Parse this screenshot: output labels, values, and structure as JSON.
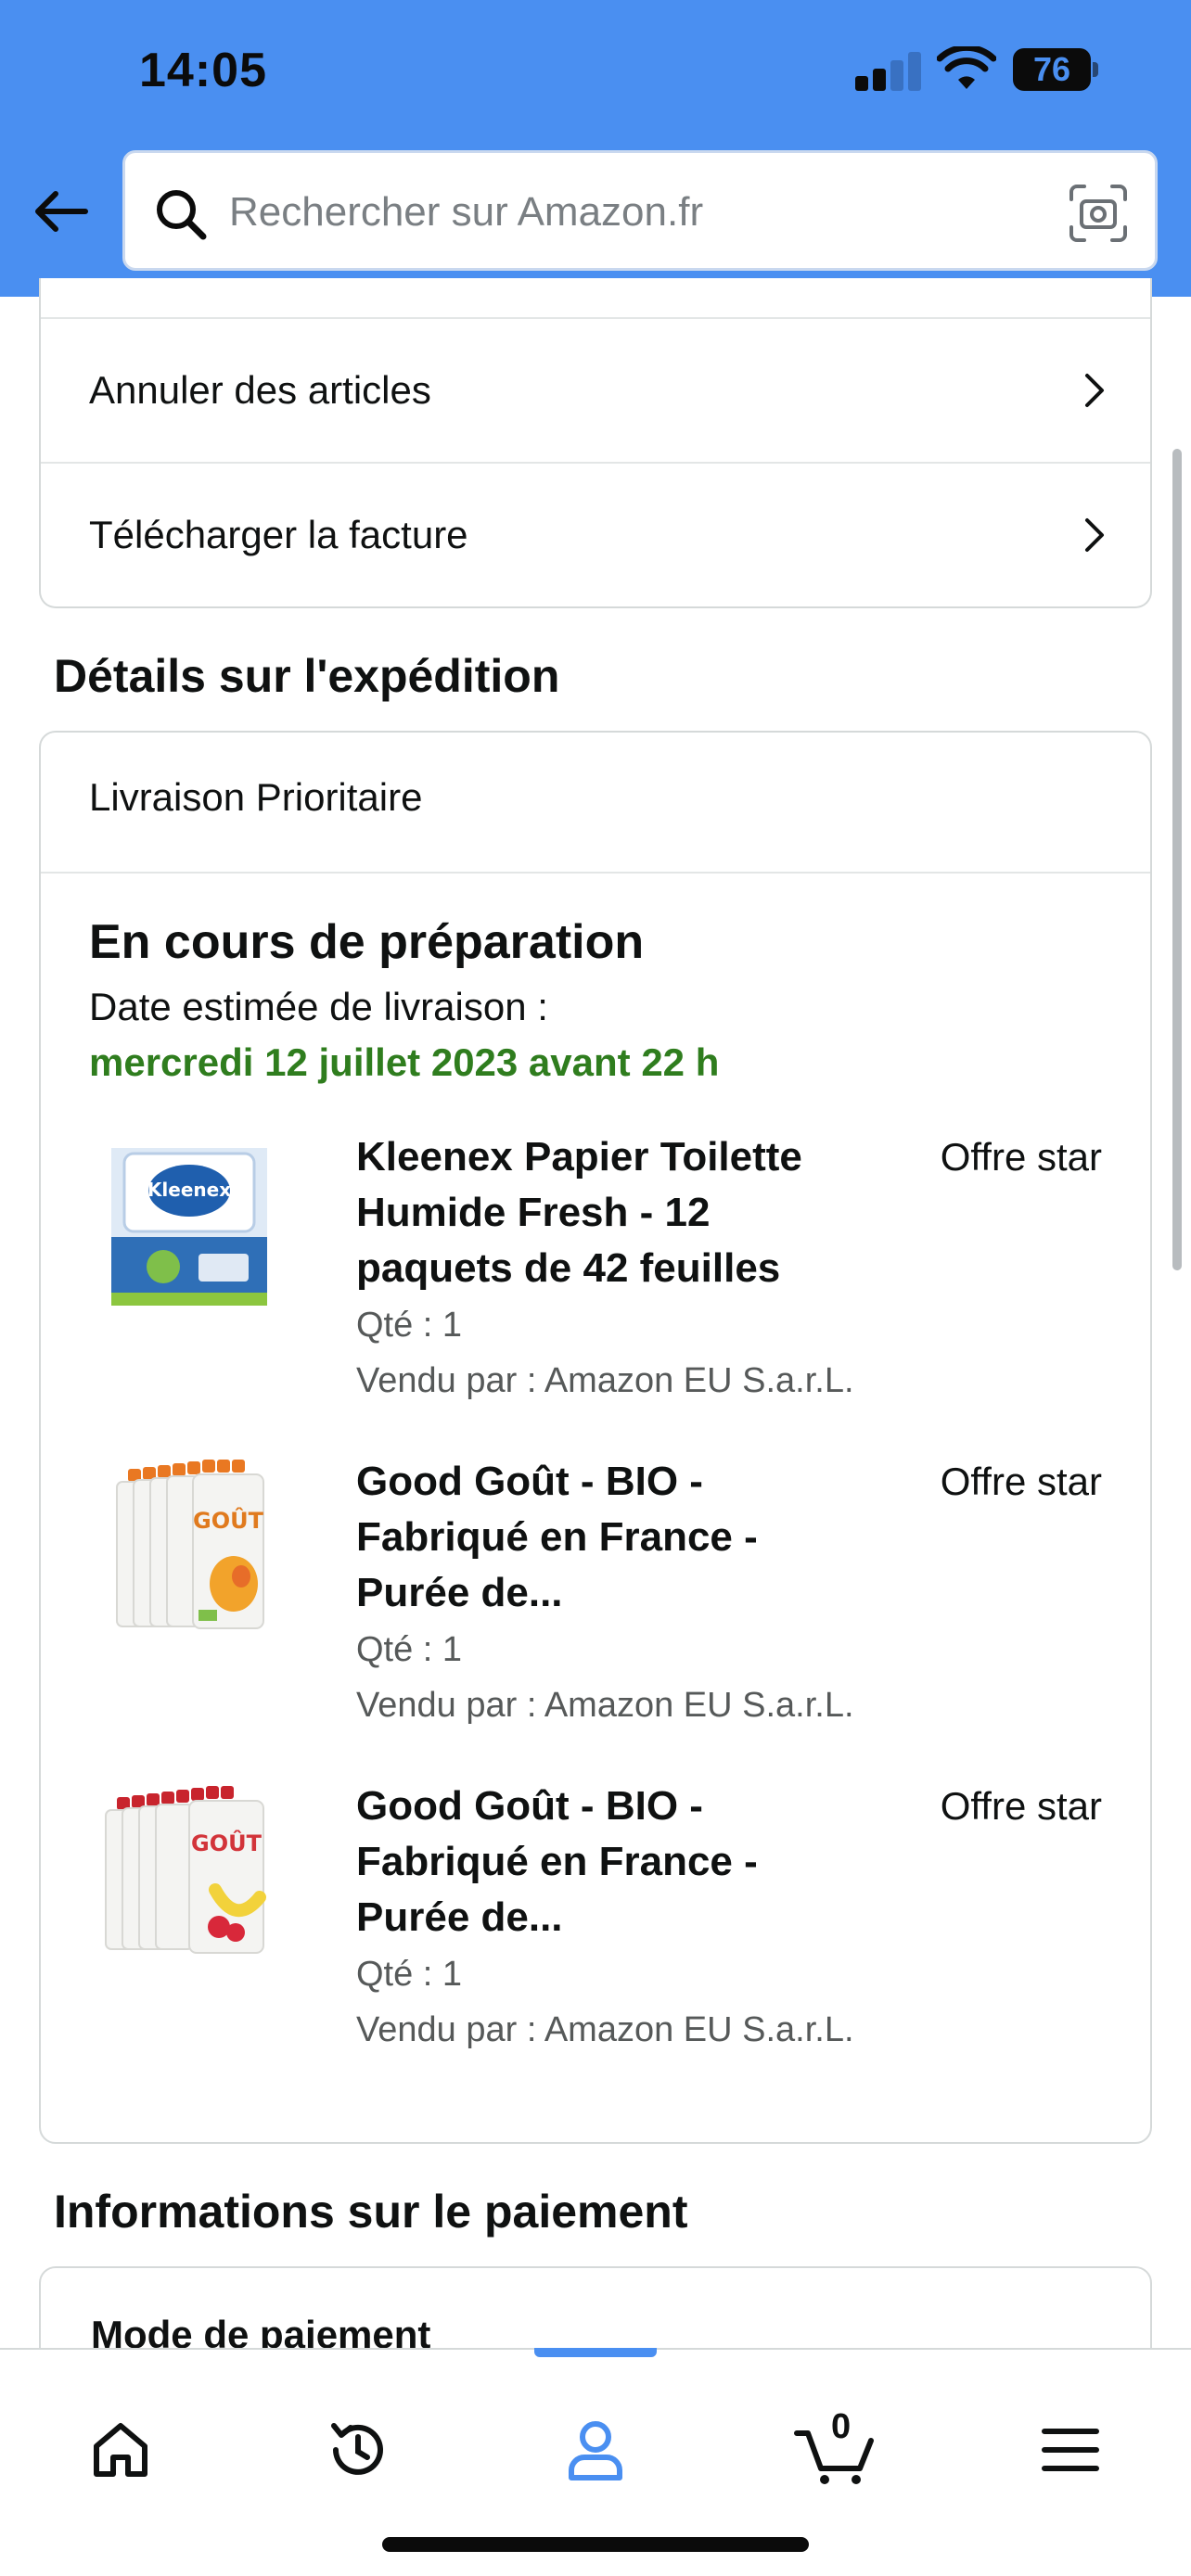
{
  "status_bar": {
    "time": "14:05",
    "battery": "76"
  },
  "search": {
    "placeholder": "Rechercher sur Amazon.fr"
  },
  "actions": [
    {
      "label": "Annuler des articles"
    },
    {
      "label": "Télécharger la facture"
    }
  ],
  "shipping": {
    "section_title": "Détails sur l'expédition",
    "method": "Livraison Prioritaire",
    "status": "En cours de préparation",
    "estimate_label": "Date estimée de livraison :",
    "estimate_date": "mercredi 12 juillet 2023 avant 22 h",
    "items": [
      {
        "title": "Kleenex Papier Toilette Humide Fresh - 12 paquets de 42 feuilles",
        "badge": "Offre star",
        "qty": "Qté : 1",
        "seller": "Vendu par : Amazon EU S.a.r.L."
      },
      {
        "title": "Good Goût - BIO - Fabriqué en France - Purée de...",
        "badge": "Offre star",
        "qty": "Qté : 1",
        "seller": "Vendu par : Amazon EU S.a.r.L."
      },
      {
        "title": "Good Goût - BIO - Fabriqué en France - Purée de...",
        "badge": "Offre star",
        "qty": "Qté : 1",
        "seller": "Vendu par : Amazon EU S.a.r.L."
      }
    ]
  },
  "payment": {
    "section_title": "Informations sur le paiement",
    "method_label": "Mode de paiement"
  },
  "bottom_nav": {
    "cart_count": "0",
    "items": [
      "home-icon",
      "history-icon",
      "account-icon",
      "cart-icon",
      "menu-icon"
    ],
    "active": "account-icon"
  },
  "colors": {
    "header": "#4a8ff1",
    "delivery_date": "#2f7d1e",
    "nav_active": "#4a8ff1"
  }
}
